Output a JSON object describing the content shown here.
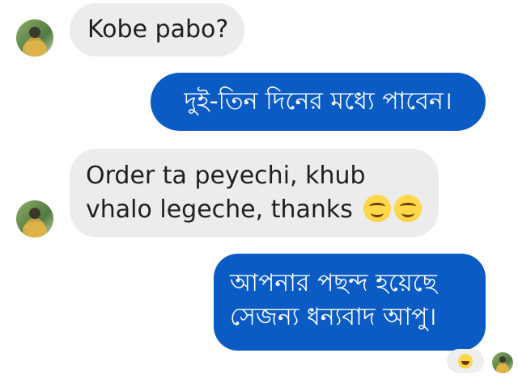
{
  "messages": [
    {
      "side": "incoming",
      "lines": [
        "Kobe pabo?"
      ]
    },
    {
      "side": "outgoing",
      "lines": [
        "দুই-তিন দিনের মধ্যে পাবেন।"
      ]
    },
    {
      "side": "incoming",
      "lines": [
        "Order ta peyechi, khub",
        "vhalo legeche, thanks"
      ],
      "emoji": [
        "smiling-face-icon",
        "smiling-face-icon"
      ]
    },
    {
      "side": "outgoing",
      "lines": [
        "আপনার পছন্দ হয়েছে",
        "সেজন্য ধন্যবাদ আপু।"
      ]
    }
  ],
  "reaction": {
    "icon": "laughing-face-icon"
  },
  "colors": {
    "incoming_bubble": "#ececec",
    "outgoing_bubble": "#0a5cc4",
    "incoming_text": "#1f1f1f",
    "outgoing_text": "#ffffff"
  }
}
